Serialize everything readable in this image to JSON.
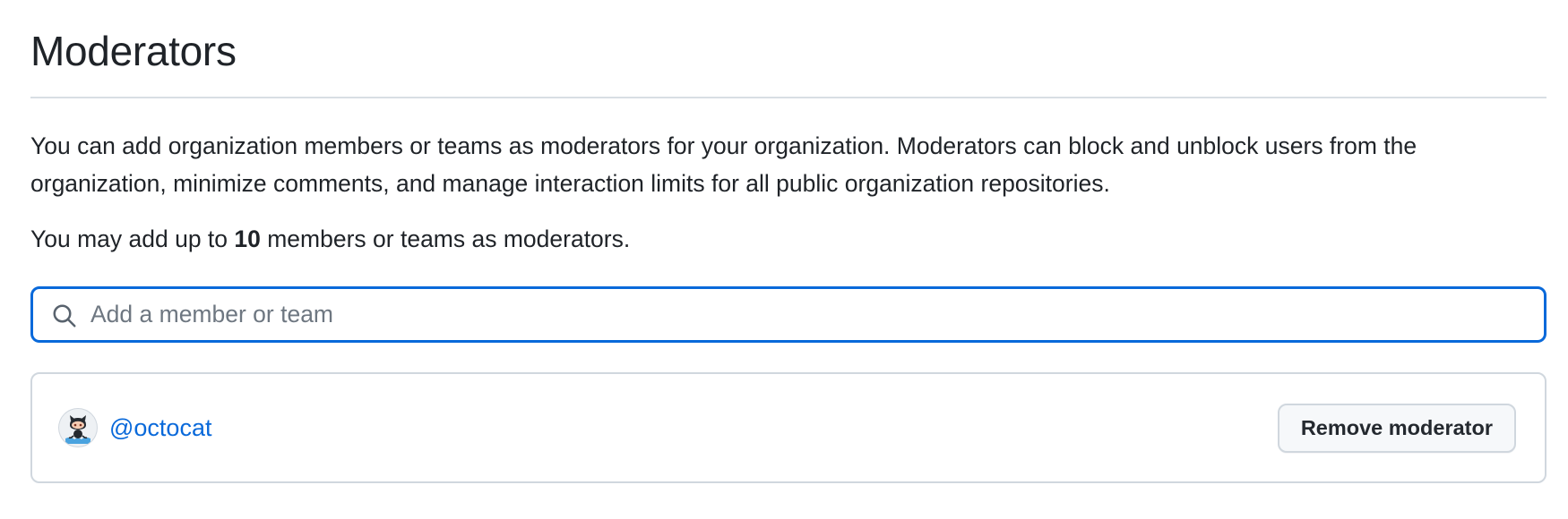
{
  "header": {
    "title": "Moderators"
  },
  "description": "You can add organization members or teams as moderators for your organization. Moderators can block and unblock users from the organization, minimize comments, and manage interaction limits for all public organization repositories.",
  "limit": {
    "prefix": "You may add up to ",
    "count": "10",
    "suffix": " members or teams as moderators."
  },
  "search": {
    "value": "",
    "placeholder": "Add a member or team",
    "icon": "search-icon"
  },
  "moderators": [
    {
      "username": "@octocat",
      "avatar_icon": "octocat-avatar",
      "remove_label": "Remove moderator"
    }
  ],
  "colors": {
    "accent": "#0969da",
    "border": "#d0d7de",
    "text": "#1f2328"
  }
}
